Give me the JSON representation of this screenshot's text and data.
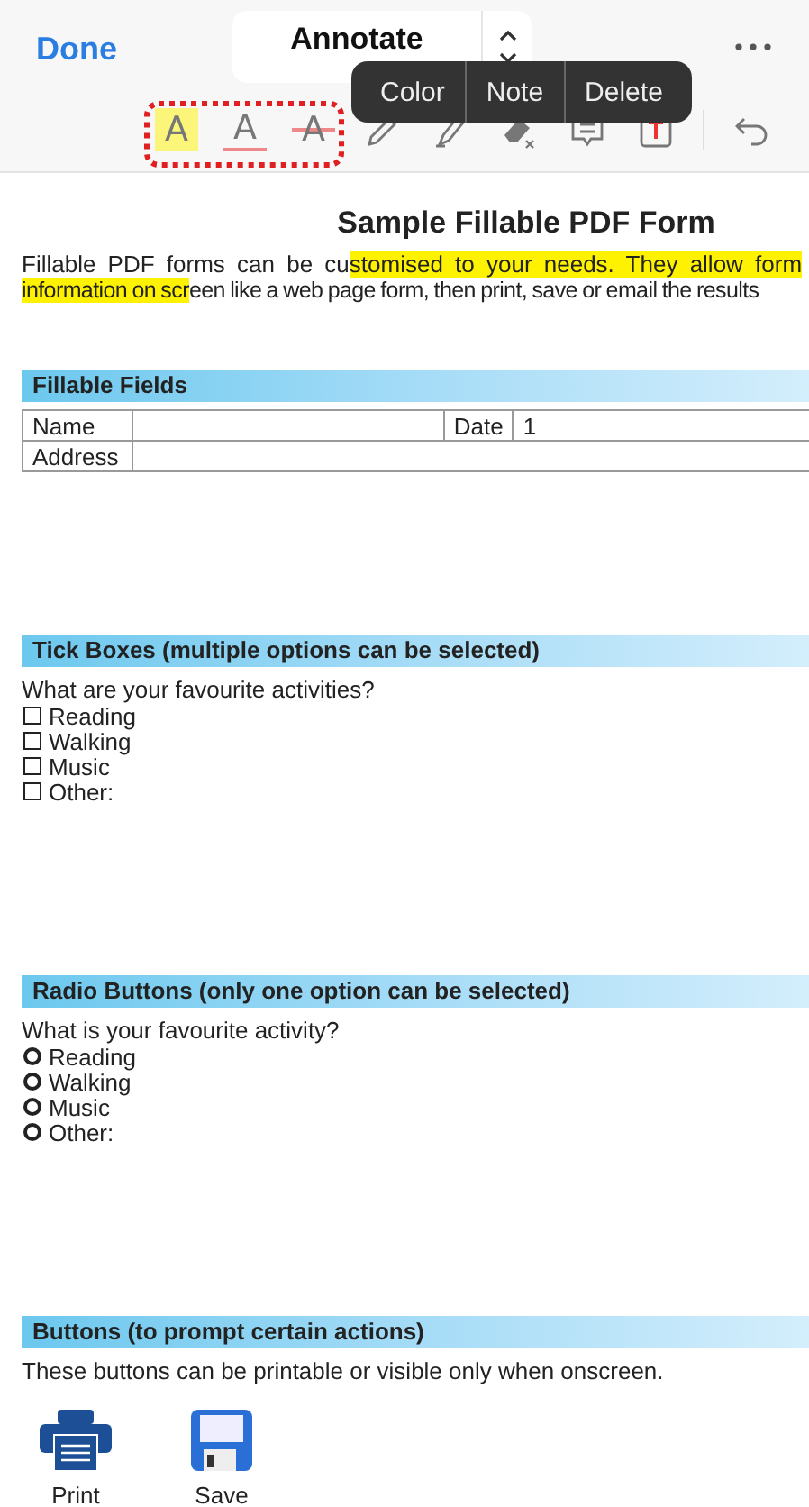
{
  "top_bar": {
    "done": "Done",
    "title": "Annotate"
  },
  "toolbar": [
    {
      "kind": "highlight",
      "glyph": "A",
      "selected": true
    },
    {
      "kind": "underline",
      "glyph": "A",
      "selected": false
    },
    {
      "kind": "strike",
      "glyph": "A",
      "selected": false
    },
    {
      "kind": "pencil",
      "selected": false
    },
    {
      "kind": "marker",
      "selected": false
    },
    {
      "kind": "eraser",
      "selected": false
    },
    {
      "kind": "comment",
      "selected": false
    },
    {
      "kind": "textbox",
      "selected": false
    },
    {
      "kind": "undo",
      "selected": false
    }
  ],
  "popup_menu": [
    "Color",
    "Note",
    "Delete"
  ],
  "document": {
    "title": "Sample Fillable PDF Form",
    "intro_lines": [
      [
        {
          "text": "Fillable PDF forms can be cu",
          "highlighted": false
        },
        {
          "text": "stomised to your needs. They allow form",
          "highlighted": true
        }
      ],
      [
        {
          "text": "information on scr",
          "highlighted": true
        },
        {
          "text": "een like a web page form, then print, save or email the results",
          "highlighted": false
        }
      ]
    ],
    "sections": [
      {
        "kind": "fields",
        "heading": "Fillable Fields",
        "rows": [
          [
            "Name",
            "",
            "Date",
            "1"
          ],
          [
            "Address",
            ""
          ]
        ]
      },
      {
        "kind": "checkboxes",
        "heading": "Tick Boxes (multiple options can be selected)",
        "question": "What are your favourite activities?",
        "options": [
          {
            "label": "Reading",
            "checked": false
          },
          {
            "label": "Walking",
            "checked": false
          },
          {
            "label": "Music",
            "checked": false
          },
          {
            "label": "Other:",
            "checked": false
          }
        ]
      },
      {
        "kind": "radios",
        "heading": "Radio Buttons (only one option can be selected)",
        "question": "What is your favourite activity?",
        "options": [
          {
            "label": "Reading",
            "selected": false
          },
          {
            "label": "Walking",
            "selected": false
          },
          {
            "label": "Music",
            "selected": false
          },
          {
            "label": "Other:",
            "selected": false
          }
        ]
      },
      {
        "kind": "buttons",
        "heading": "Buttons (to prompt certain actions)",
        "question": "These buttons can be printable or visible only when onscreen.",
        "buttons": [
          {
            "kind": "print",
            "label": "Print"
          },
          {
            "kind": "save",
            "label": "Save"
          }
        ]
      }
    ]
  }
}
